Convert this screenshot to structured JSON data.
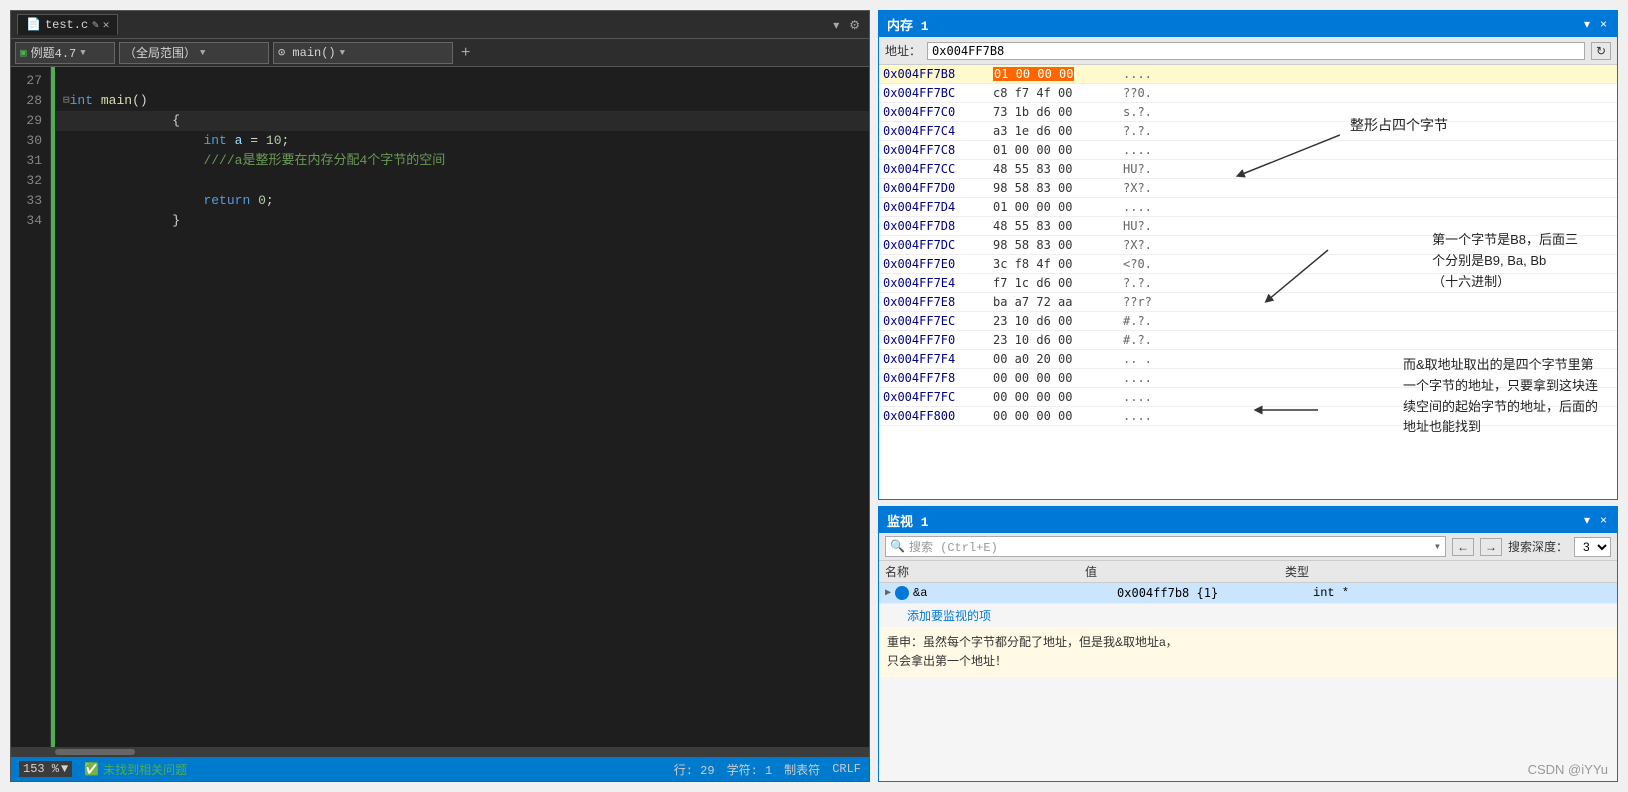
{
  "editor": {
    "tab_name": "test.c",
    "tab_icon": "📄",
    "dropdown1": "例题4.7",
    "dropdown2": "（全局范围）",
    "dropdown3": "⊙ main()",
    "lines": [
      {
        "num": "27",
        "content": "",
        "type": "empty"
      },
      {
        "num": "28",
        "content": "⊟int main()",
        "type": "function",
        "parts": [
          {
            "text": "⊟",
            "cls": "collapse"
          },
          {
            "text": "int",
            "cls": "kw"
          },
          " ",
          {
            "text": "main",
            "cls": "fn"
          },
          {
            "text": "()",
            "cls": "punct"
          }
        ]
      },
      {
        "num": "29",
        "content": "    {",
        "type": "brace",
        "current": true
      },
      {
        "num": "30",
        "content": "        int a = 10;",
        "type": "code"
      },
      {
        "num": "31",
        "content": "        ////a是整形要在内存分配4个字节的空间",
        "type": "comment"
      },
      {
        "num": "32",
        "content": "",
        "type": "empty"
      },
      {
        "num": "33",
        "content": "        return 0;",
        "type": "code"
      },
      {
        "num": "34",
        "content": "    }",
        "type": "brace"
      }
    ],
    "status": {
      "zoom": "153 %",
      "no_issues": "✅ 未找到相关问题",
      "row": "行: 29",
      "col": "学符: 1",
      "tab": "制表符",
      "encoding": "CRLF"
    }
  },
  "memory_panel": {
    "title": "内存 1",
    "address_label": "地址：",
    "address_value": "0x004FF7B8",
    "refresh_label": "↻",
    "pin_label": "▾",
    "close_label": "×",
    "rows": [
      {
        "addr": "0x004FF7B8",
        "bytes": "01 00 00 00",
        "chars": "....",
        "highlighted": true
      },
      {
        "addr": "0x004FF7BC",
        "bytes": "c8 f7 4f 00",
        "chars": "??0."
      },
      {
        "addr": "0x004FF7C0",
        "bytes": "73 1b d6 00",
        "chars": "s.?."
      },
      {
        "addr": "0x004FF7C4",
        "bytes": "a3 1e d6 00",
        "chars": "?.?."
      },
      {
        "addr": "0x004FF7C8",
        "bytes": "01 00 00 00",
        "chars": "...."
      },
      {
        "addr": "0x004FF7CC",
        "bytes": "48 55 83 00",
        "chars": "HU?."
      },
      {
        "addr": "0x004FF7D0",
        "bytes": "98 58 83 00",
        "chars": "?X?."
      },
      {
        "addr": "0x004FF7D4",
        "bytes": "01 00 00 00",
        "chars": "...."
      },
      {
        "addr": "0x004FF7D8",
        "bytes": "48 55 83 00",
        "chars": "HU?."
      },
      {
        "addr": "0x004FF7DC",
        "bytes": "98 58 83 00",
        "chars": "?X?."
      },
      {
        "addr": "0x004FF7E0",
        "bytes": "3c f8 4f 00",
        "chars": "<?."
      },
      {
        "addr": "0x004FF7E4",
        "bytes": "f7 1c d6 00",
        "chars": "?.?."
      },
      {
        "addr": "0x004FF7E8",
        "bytes": "ba a7 72 aa",
        "chars": "??r?"
      },
      {
        "addr": "0x004FF7EC",
        "bytes": "23 10 d6 00",
        "chars": "#.?."
      },
      {
        "addr": "0x004FF7F0",
        "bytes": "23 10 d6 00",
        "chars": "#.?."
      },
      {
        "addr": "0x004FF7F4",
        "bytes": "00 a0 20 00",
        "chars": ".. ."
      },
      {
        "addr": "0x004FF7F8",
        "bytes": "00 00 00 00",
        "chars": "...."
      },
      {
        "addr": "0x004FF7FC",
        "bytes": "00 00 00 00",
        "chars": "...."
      },
      {
        "addr": "0x004FF800",
        "bytes": "00 00 00 00",
        "chars": "...."
      }
    ]
  },
  "annotations": {
    "note1": "整形占四个字节",
    "note2_line1": "第一个字节是B8，后面三",
    "note2_line2": "个分别是B9, Ba, Bb",
    "note2_line3": "（十六进制）",
    "note3_line1": "而&取地址取出的是四个字节里第",
    "note3_line2": "一个字节的地址，只要拿到这块连",
    "note3_line3": "续空间的起始字节的地址，后面的",
    "note3_line4": "地址也能找到"
  },
  "monitor_panel": {
    "title": "监视 1",
    "search_placeholder": "搜索 (Ctrl+E)",
    "search_icon": "🔍",
    "depth_label": "搜索深度：",
    "depth_value": "3",
    "nav_prev": "←",
    "nav_next": "→",
    "pin_label": "▾",
    "close_label": "×",
    "col_name": "名称",
    "col_value": "值",
    "col_type": "类型",
    "rows": [
      {
        "expand": "▶",
        "icon": "●",
        "name": "&a",
        "value": "0x004ff7b8 {1}",
        "type": "int *",
        "selected": true
      }
    ],
    "add_label": "添加要监视的项",
    "note_line1": "重申：虽然每个字节都分配了地址，但是我&取地址a，",
    "note_line2": "只会拿出第一个地址！"
  },
  "watermark": "CSDN @iYYu"
}
